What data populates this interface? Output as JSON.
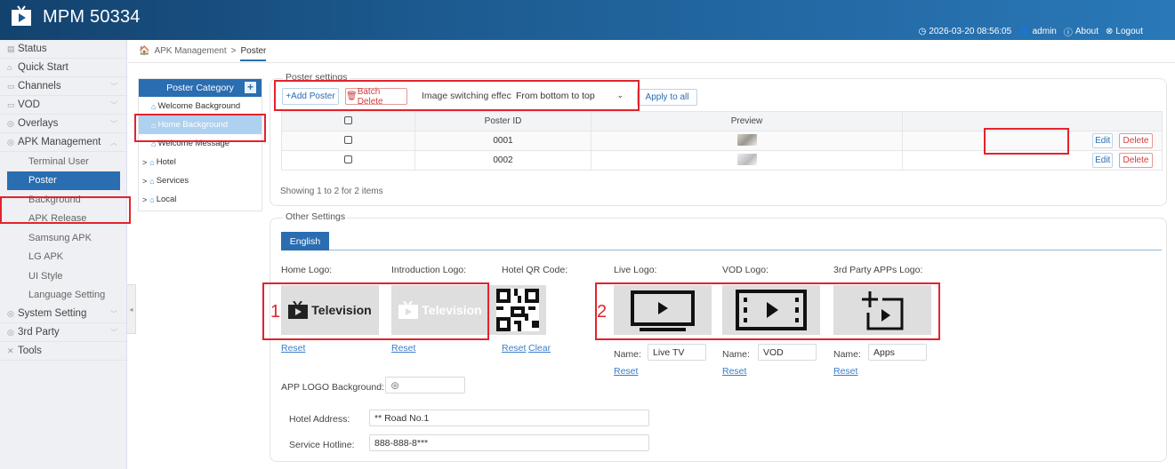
{
  "app": {
    "title": "MPM 50334"
  },
  "header": {
    "datetime": "2026-03-20 08:56:05",
    "user": "admin",
    "about": "About",
    "logout": "Logout"
  },
  "sidebar": {
    "items": [
      {
        "label": "Status",
        "icon": "status-icon"
      },
      {
        "label": "Quick Start",
        "icon": "quickstart-icon"
      },
      {
        "label": "Channels",
        "icon": "channels-icon"
      },
      {
        "label": "VOD",
        "icon": "vod-icon"
      },
      {
        "label": "Overlays",
        "icon": "overlays-icon"
      },
      {
        "label": "APK Management",
        "icon": "apk-icon"
      }
    ],
    "apk_sub": [
      "Terminal User",
      "Poster",
      "Background",
      "APK Release",
      "Samsung APK",
      "LG APK",
      "UI Style",
      "Language Setting"
    ],
    "bottom": [
      {
        "label": "System Setting"
      },
      {
        "label": "3rd Party"
      },
      {
        "label": "Tools"
      }
    ]
  },
  "breadcrumb": {
    "home": "APK Management",
    "sep": ">",
    "current": "Poster"
  },
  "category": {
    "header": "Poster Category",
    "items": [
      "Welcome Background",
      "Home Background",
      "Welcome Message",
      "Hotel",
      "Services",
      "Local"
    ]
  },
  "poster_settings": {
    "legend": "Poster settings",
    "add": "+Add Poster",
    "batch_delete": "Batch Delete",
    "effect_label": "Image switching effect:",
    "effect_value": "From bottom to top",
    "apply_all": "Apply to all",
    "columns": [
      "Poster ID",
      "Preview"
    ],
    "rows": [
      {
        "id": "0001"
      },
      {
        "id": "0002"
      }
    ],
    "edit": "Edit",
    "delete": "Delete",
    "footer": "Showing 1 to 2 for 2 items"
  },
  "other_settings": {
    "legend": "Other Settings",
    "tab": "English",
    "logos": {
      "home": "Home Logo:",
      "intro": "Introduction Logo:",
      "qr": "Hotel QR Code:",
      "live": "Live Logo:",
      "vod": "VOD Logo:",
      "third": "3rd Party APPs Logo:"
    },
    "television_text": "Television",
    "reset": "Reset",
    "clear": "Clear",
    "name_label": "Name:",
    "live_name": "Live TV",
    "vod_name": "VOD",
    "apps_name": "Apps",
    "app_logo_bg": "APP LOGO Background:",
    "hotel_address_label": "Hotel Address:",
    "hotel_address": "** Road No.1",
    "hotline_label": "Service Hotline:",
    "hotline": "888-888-8***"
  },
  "annotations": {
    "one": "1",
    "two": "2"
  },
  "colors": {
    "header": "#1d5c92",
    "accent": "#2a6db0",
    "highlight": "#e4232b"
  }
}
